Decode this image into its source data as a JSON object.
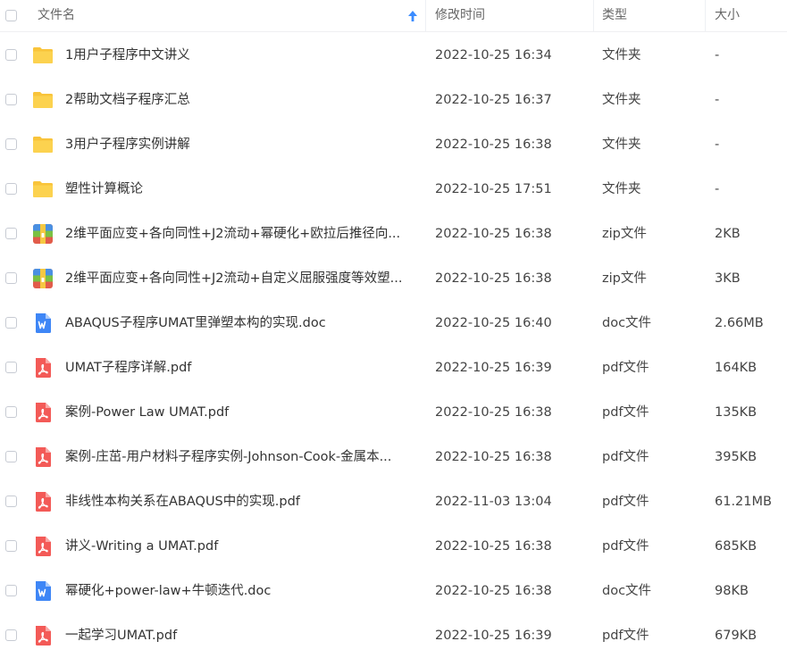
{
  "columns": {
    "name": "文件名",
    "modified": "修改时间",
    "type": "类型",
    "size": "大小"
  },
  "colors": {
    "folder": "#f9c43b",
    "pdf": "#f35a57",
    "doc": "#3e86f6",
    "sort_arrow": "#3b8cff"
  },
  "files": [
    {
      "name": "1用户子程序中文讲义",
      "modified": "2022-10-25 16:34",
      "type": "文件夹",
      "size": "-",
      "icon": "folder-icon"
    },
    {
      "name": "2帮助文档子程序汇总",
      "modified": "2022-10-25 16:37",
      "type": "文件夹",
      "size": "-",
      "icon": "folder-icon"
    },
    {
      "name": "3用户子程序实例讲解",
      "modified": "2022-10-25 16:38",
      "type": "文件夹",
      "size": "-",
      "icon": "folder-icon"
    },
    {
      "name": "塑性计算概论",
      "modified": "2022-10-25 17:51",
      "type": "文件夹",
      "size": "-",
      "icon": "folder-icon"
    },
    {
      "name": "2维平面应变+各向同性+J2流动+幂硬化+欧拉后推径向...",
      "modified": "2022-10-25 16:38",
      "type": "zip文件",
      "size": "2KB",
      "icon": "zip-icon"
    },
    {
      "name": "2维平面应变+各向同性+J2流动+自定义屈服强度等效塑...",
      "modified": "2022-10-25 16:38",
      "type": "zip文件",
      "size": "3KB",
      "icon": "zip-icon"
    },
    {
      "name": "ABAQUS子程序UMAT里弹塑本构的实现.doc",
      "modified": "2022-10-25 16:40",
      "type": "doc文件",
      "size": "2.66MB",
      "icon": "doc-icon"
    },
    {
      "name": "UMAT子程序详解.pdf",
      "modified": "2022-10-25 16:39",
      "type": "pdf文件",
      "size": "164KB",
      "icon": "pdf-icon"
    },
    {
      "name": "案例-Power Law UMAT.pdf",
      "modified": "2022-10-25 16:38",
      "type": "pdf文件",
      "size": "135KB",
      "icon": "pdf-icon"
    },
    {
      "name": "案例-庄茁-用户材料子程序实例-Johnson-Cook-金属本...",
      "modified": "2022-10-25 16:38",
      "type": "pdf文件",
      "size": "395KB",
      "icon": "pdf-icon"
    },
    {
      "name": "非线性本构关系在ABAQUS中的实现.pdf",
      "modified": "2022-11-03 13:04",
      "type": "pdf文件",
      "size": "61.21MB",
      "icon": "pdf-icon"
    },
    {
      "name": "讲义-Writing a UMAT.pdf",
      "modified": "2022-10-25 16:38",
      "type": "pdf文件",
      "size": "685KB",
      "icon": "pdf-icon"
    },
    {
      "name": "幂硬化+power-law+牛顿迭代.doc",
      "modified": "2022-10-25 16:38",
      "type": "doc文件",
      "size": "98KB",
      "icon": "doc-icon"
    },
    {
      "name": "一起学习UMAT.pdf",
      "modified": "2022-10-25 16:39",
      "type": "pdf文件",
      "size": "679KB",
      "icon": "pdf-icon"
    }
  ]
}
